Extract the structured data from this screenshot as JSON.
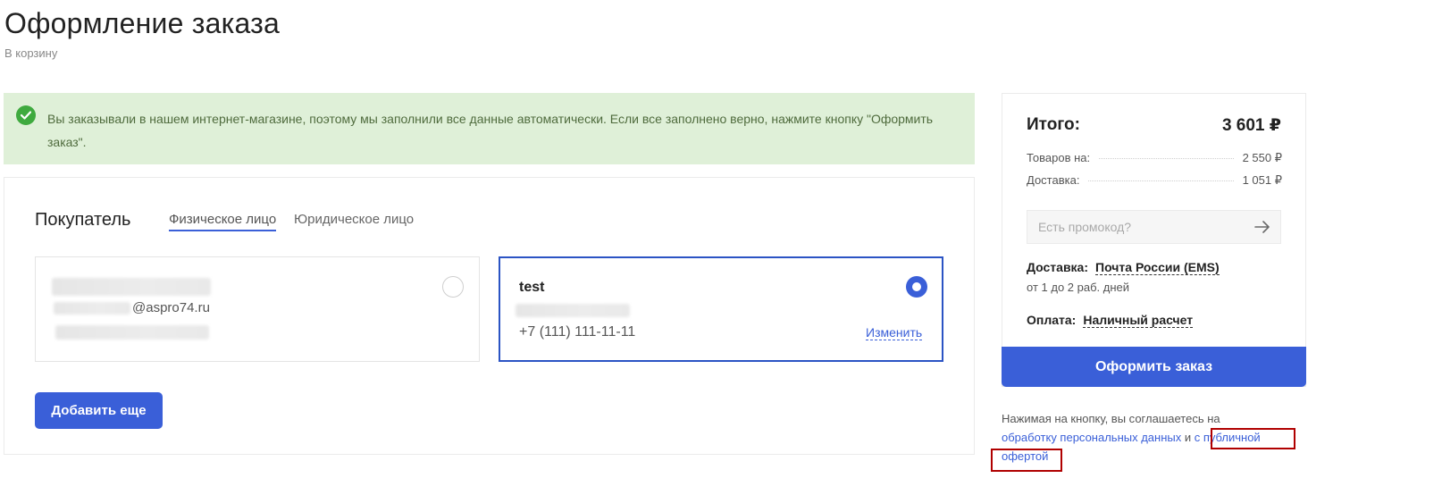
{
  "header": {
    "title": "Оформление заказа",
    "back_link": "В корзину"
  },
  "notice": {
    "text": "Вы заказывали в нашем интернет-магазине, поэтому мы заполнили все данные автоматически. Если все заполнено верно, нажмите кнопку \"Оформить заказ\".",
    "icon": "check-circle-icon",
    "color": "#dff0d8"
  },
  "buyer": {
    "title": "Покупатель",
    "tabs": [
      {
        "label": "Физическое лицо",
        "active": true
      },
      {
        "label": "Юридическое лицо",
        "active": false
      }
    ],
    "profiles": [
      {
        "name": "",
        "email_suffix": "@aspro74.ru",
        "phone": "",
        "selected": false
      },
      {
        "name": "test",
        "phone": "+7 (111) 111-11-11",
        "edit_label": "Изменить",
        "selected": true
      }
    ],
    "add_button": "Добавить еще"
  },
  "summary": {
    "total_label": "Итого:",
    "total_value": "3 601 ₽",
    "goods_label": "Товаров на:",
    "goods_value": "2 550 ₽",
    "delivery_label": "Доставка:",
    "delivery_value": "1 051 ₽",
    "promo_placeholder": "Есть промокод?",
    "shipping_label": "Доставка:",
    "shipping_method": "Почта России (EMS)",
    "shipping_time": "от 1 до 2 раб. дней",
    "payment_label": "Оплата:",
    "payment_method": "Наличный расчет",
    "order_button": "Оформить заказ"
  },
  "agreement": {
    "text_before": "Нажимая на кнопку, вы соглашаетесь на",
    "link_privacy": "обработку персональных данных",
    "conjunction": " и ",
    "link_offer_part1": "с публичной",
    "link_offer_part2": "офертой"
  },
  "colors": {
    "accent": "#3a5fd8",
    "notice_bg": "#dff0d8",
    "highlight": "#b00000"
  }
}
